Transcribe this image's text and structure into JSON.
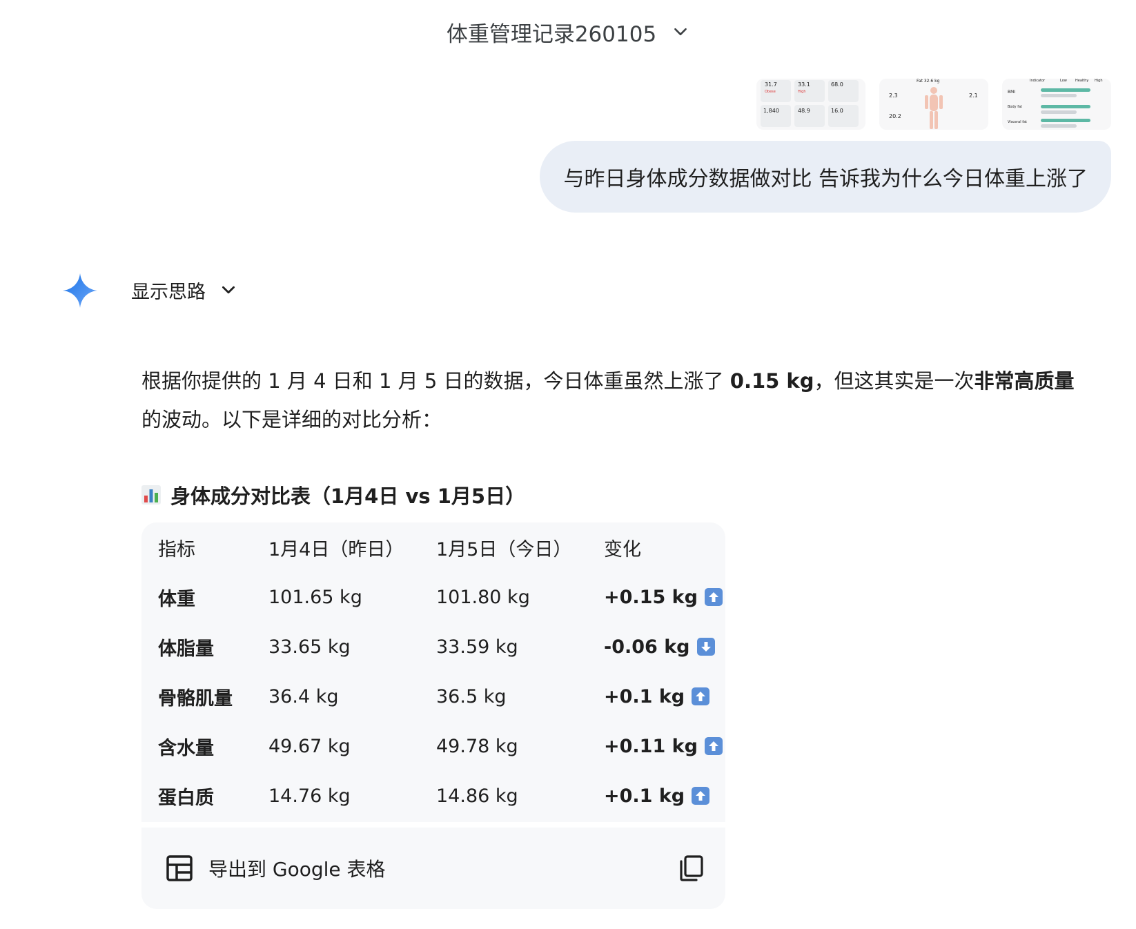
{
  "header": {
    "chat_title": "体重管理记录260105"
  },
  "attachments": {
    "thumb1": {
      "v1": "31.7",
      "v2": "33.1",
      "v3": "68.0",
      "v4": "1,840",
      "v5": "48.9",
      "v6": "16.0",
      "tag1": "Obese",
      "tag2": "High"
    },
    "thumb2": {
      "title": "Fat 32.6 kg",
      "a": "2.3",
      "b": "2.1",
      "c": "20.2"
    },
    "thumb3": {
      "h1": "Indicator",
      "h2": "Low",
      "h3": "Healthy",
      "h4": "High",
      "r1": "BMI",
      "r2": "Body fat",
      "r3": "Visceral fat"
    }
  },
  "user_message": {
    "text": "与昨日身体成分数据做对比 告诉我为什么今日体重上涨了"
  },
  "thinking": {
    "label": "显示思路"
  },
  "answer": {
    "p1_a": "根据你提供的 1 月 4 日和 1 月 5 日的数据，今日体重虽然上涨了 ",
    "p1_b": "0.15 kg",
    "p1_c": "，但这其实是一次",
    "p1_d": "非常高质量",
    "p1_e": "的波动。以下是详细的对比分析："
  },
  "table": {
    "heading": "身体成分对比表（1月4日 vs 1月5日）",
    "headers": [
      "指标",
      "1月4日（昨日）",
      "1月5日（今日）",
      "变化"
    ],
    "rows": [
      {
        "name": "体重",
        "yesterday": "101.65 kg",
        "today": "101.80 kg",
        "change": "+0.15 kg",
        "direction": "up"
      },
      {
        "name": "体脂量",
        "yesterday": "33.65 kg",
        "today": "33.59 kg",
        "change": "-0.06 kg",
        "direction": "down"
      },
      {
        "name": "骨骼肌量",
        "yesterday": "36.4 kg",
        "today": "36.5 kg",
        "change": "+0.1 kg",
        "direction": "up"
      },
      {
        "name": "含水量",
        "yesterday": "49.67 kg",
        "today": "49.78 kg",
        "change": "+0.11 kg",
        "direction": "up"
      },
      {
        "name": "蛋白质",
        "yesterday": "14.76 kg",
        "today": "14.86 kg",
        "change": "+0.1 kg",
        "direction": "up"
      }
    ]
  },
  "export": {
    "label": "导出到 Google 表格"
  },
  "colors": {
    "accent": "#4285f4",
    "bubble": "#e9eef6",
    "card": "#f7f8fa",
    "badge": "#5b8fd8"
  }
}
